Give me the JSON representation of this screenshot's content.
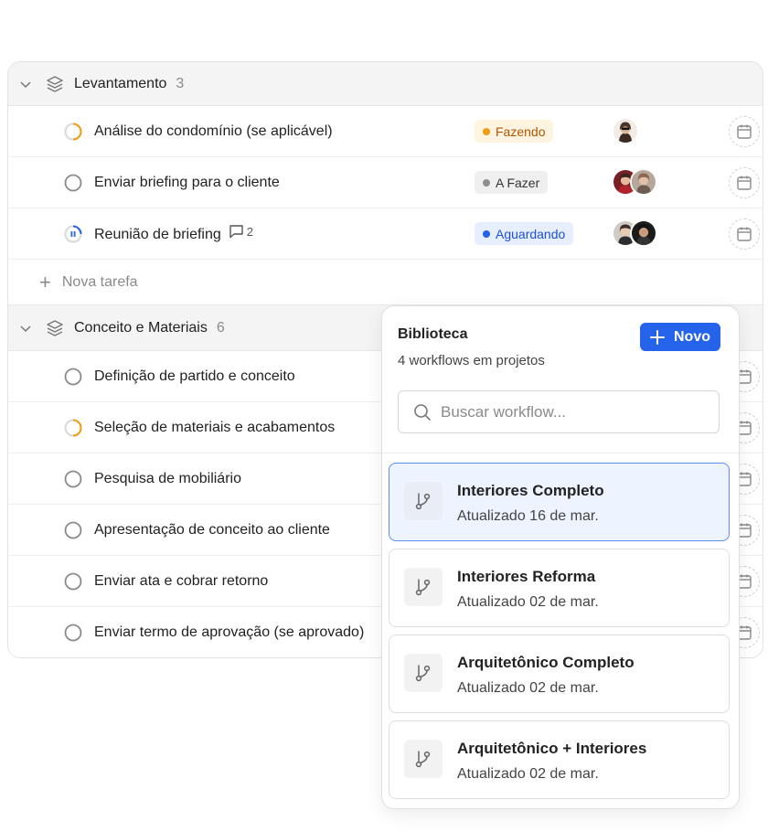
{
  "groups": [
    {
      "title": "Levantamento",
      "count": "3",
      "tasks": [
        {
          "title": "Análise do condomínio (se aplicável)",
          "status": "Fazendo"
        },
        {
          "title": "Enviar briefing para o cliente",
          "status": "A Fazer"
        },
        {
          "title": "Reunião de briefing",
          "status": "Aguardando",
          "comments": "2"
        }
      ],
      "new_task": "Nova tarefa"
    },
    {
      "title": "Conceito e Materiais",
      "count": "6",
      "tasks": [
        {
          "title": "Definição de partido e conceito"
        },
        {
          "title": "Seleção de materiais e acabamentos"
        },
        {
          "title": "Pesquisa de mobiliário"
        },
        {
          "title": "Apresentação de conceito ao cliente"
        },
        {
          "title": "Enviar ata e cobrar retorno"
        },
        {
          "title": "Enviar termo de aprovação (se aprovado)"
        }
      ]
    }
  ],
  "library": {
    "title": "Biblioteca",
    "subtitle": "4 workflows em projetos",
    "new_label": "Novo",
    "search_placeholder": "Buscar workflow...",
    "workflows": [
      {
        "name": "Interiores Completo",
        "updated": "Atualizado 16 de mar."
      },
      {
        "name": "Interiores Reforma",
        "updated": "Atualizado 02 de mar."
      },
      {
        "name": "Arquitetônico Completo",
        "updated": "Atualizado 02 de mar."
      },
      {
        "name": "Arquitetônico + Interiores",
        "updated": "Atualizado 02 de mar."
      }
    ]
  },
  "colors": {
    "accent": "#2563eb",
    "fazendo": "#f39c12",
    "afazer": "#8e8e8e",
    "aguardando": "#2563eb"
  }
}
